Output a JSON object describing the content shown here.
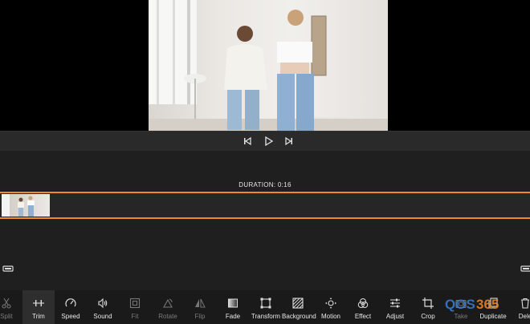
{
  "playback": {
    "prev_icon": "skip-back-icon",
    "play_icon": "play-icon",
    "next_icon": "skip-forward-icon"
  },
  "timeline": {
    "duration_text": "DURATION: 0:16"
  },
  "toolbar": {
    "items": [
      {
        "label": "Split",
        "icon": "scissors-icon",
        "enabled": false
      },
      {
        "label": "Trim",
        "icon": "trim-icon",
        "enabled": true,
        "active": true
      },
      {
        "label": "Speed",
        "icon": "speedometer-icon",
        "enabled": true
      },
      {
        "label": "Sound",
        "icon": "speaker-icon",
        "enabled": true
      },
      {
        "label": "Fit",
        "icon": "fit-icon",
        "enabled": false
      },
      {
        "label": "Rotate",
        "icon": "rotate-icon",
        "enabled": false
      },
      {
        "label": "Flip",
        "icon": "flip-icon",
        "enabled": false
      },
      {
        "label": "Fade",
        "icon": "fade-icon",
        "enabled": true
      },
      {
        "label": "Transform",
        "icon": "transform-icon",
        "enabled": true
      },
      {
        "label": "Background",
        "icon": "background-icon",
        "enabled": true
      },
      {
        "label": "Motion",
        "icon": "motion-icon",
        "enabled": true
      },
      {
        "label": "Effect",
        "icon": "effect-icon",
        "enabled": true
      },
      {
        "label": "Adjust",
        "icon": "sliders-icon",
        "enabled": true
      },
      {
        "label": "Crop",
        "icon": "crop-icon",
        "enabled": true
      },
      {
        "label": "Take",
        "icon": "camera-icon",
        "enabled": false
      },
      {
        "label": "Duplicate",
        "icon": "duplicate-icon",
        "enabled": true
      },
      {
        "label": "Dele",
        "icon": "trash-icon",
        "enabled": true
      }
    ]
  },
  "watermark": {
    "text": "QOS365"
  },
  "colors": {
    "accent": "#f08a24",
    "background": "#1f1f1f",
    "toolbar": "#1a1a1a"
  }
}
